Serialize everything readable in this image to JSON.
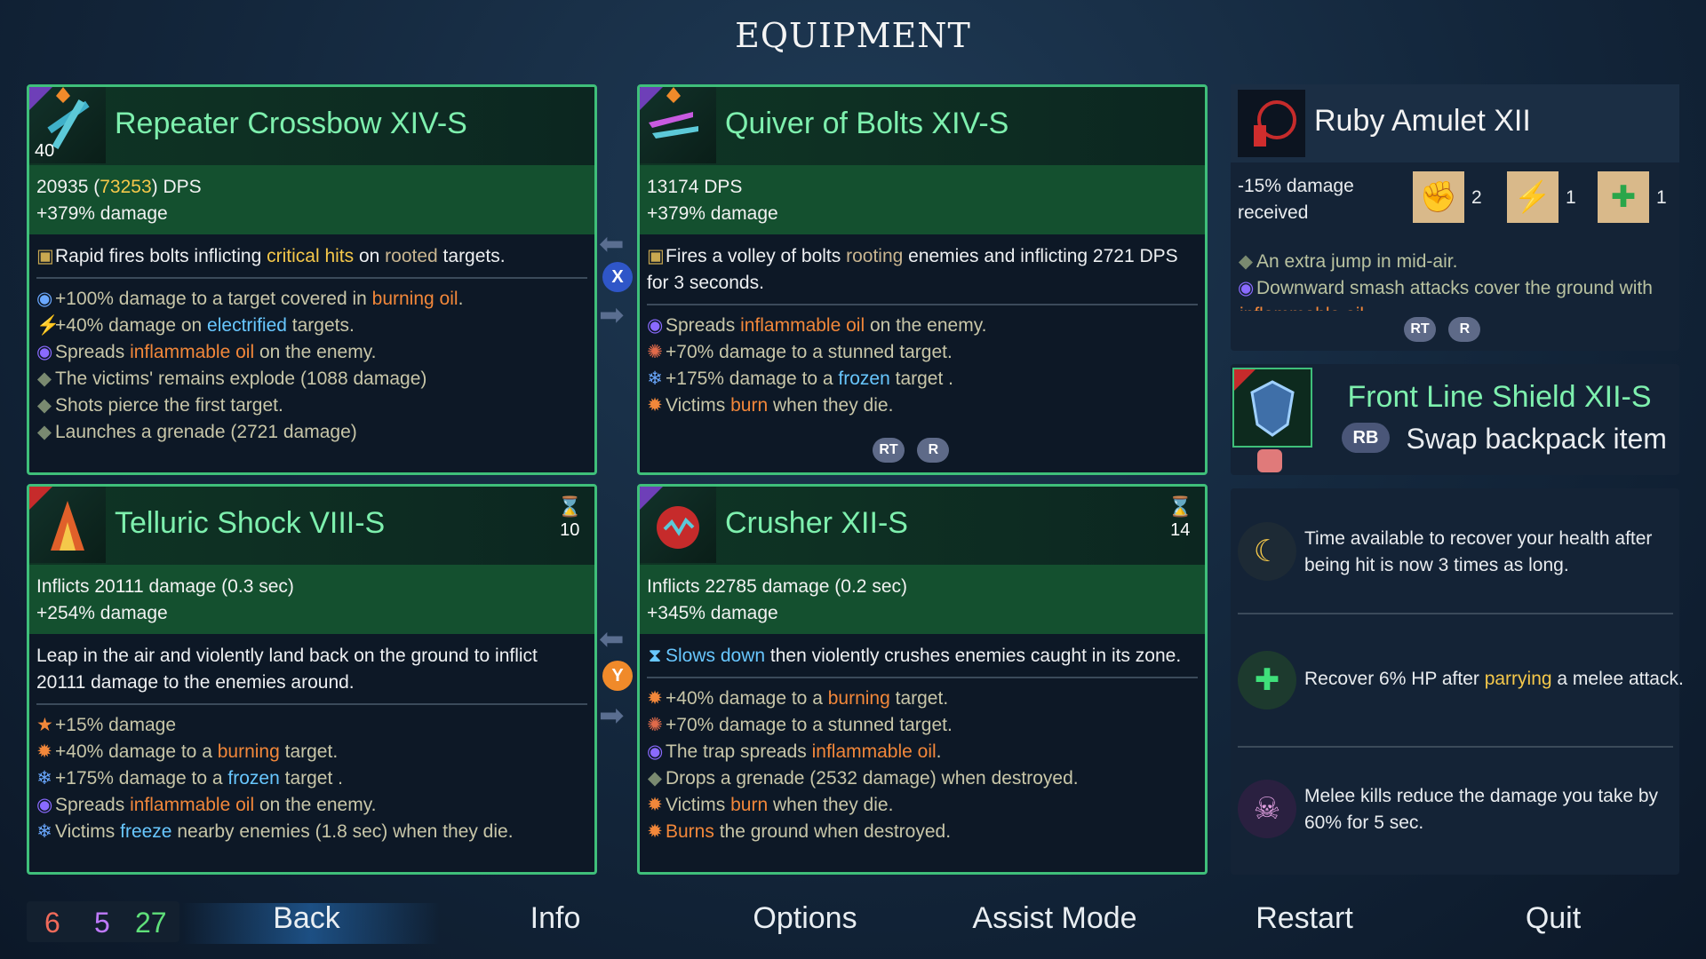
{
  "title": "EQUIPMENT",
  "weapon1": {
    "name": "Repeater Crossbow XIV-S",
    "level": "40",
    "dps_main": "20935 (",
    "dps_gold": "73253",
    "dps_suffix": ") DPS",
    "damage": "+379% damage",
    "desc_pre": "Rapid fires bolts inflicting ",
    "desc_crit": "critical hits",
    "desc_mid": " on ",
    "desc_root": "rooted",
    "desc_end": " targets.",
    "l1a": "+100% damage to a target covered in ",
    "l1b": "burning oil",
    "l1c": ".",
    "l2a": "+40% damage on ",
    "l2b": "electrified",
    "l2c": " targets.",
    "l3a": "Spreads ",
    "l3b": "inflammable oil",
    "l3c": " on the enemy.",
    "l4": "The victims' remains explode (1088 damage)",
    "l5": "Shots pierce the first target.",
    "l6": "Launches a grenade (2721 damage)"
  },
  "weapon2": {
    "name": "Quiver of Bolts XIV-S",
    "dps": "13174 DPS",
    "damage": "+379% damage",
    "desc_pre": "Fires a volley of bolts ",
    "desc_root": "rooting",
    "desc_end": " enemies and inflicting 2721 DPS for 3 seconds.",
    "l1a": "Spreads ",
    "l1b": "inflammable oil",
    "l1c": " on the enemy.",
    "l2": "+70% damage to a stunned target.",
    "l3a": "+175% damage to a ",
    "l3b": "frozen",
    "l3c": " target .",
    "l4a": "Victims ",
    "l4b": "burn",
    "l4c": " when they die.",
    "hint_rt": "RT",
    "hint_r": "R"
  },
  "amulet": {
    "name": "Ruby Amulet XII",
    "stat": "-15% damage received",
    "scroll1": "2",
    "scroll2": "1",
    "scroll3": "1",
    "l1": "An extra jump in mid-air.",
    "l2": "Downward smash attacks cover the ground with",
    "l2b": "inflammable oil",
    "hint_rt": "RT",
    "hint_r": "R"
  },
  "shield": {
    "name": "Front Line Shield XII-S",
    "rb": "RB",
    "swap": "Swap backpack item"
  },
  "mutations": [
    {
      "text": "Time available to recover your health after being hit is now 3 times as long."
    },
    {
      "pre": "Recover 6% HP after ",
      "hl": "parrying",
      "post": " a melee attack."
    },
    {
      "text": "Melee kills reduce the damage you take by 60% for 5 sec."
    }
  ],
  "skill1": {
    "name": "Telluric Shock VIII-S",
    "cooldown": "10",
    "dmg": "Inflicts 20111 damage (0.3 sec)",
    "damage": "+254% damage",
    "desc": "Leap in the air and violently land back on the ground to inflict 20111 damage to the enemies around.",
    "l1": "+15% damage",
    "l2a": "+40% damage to a ",
    "l2b": "burning",
    "l2c": " target.",
    "l3a": "+175% damage to a ",
    "l3b": "frozen",
    "l3c": " target .",
    "l4a": "Spreads ",
    "l4b": "inflammable oil",
    "l4c": " on the enemy.",
    "l5a": "Victims ",
    "l5b": "freeze",
    "l5c": " nearby enemies (1.8 sec) when they die."
  },
  "skill2": {
    "name": "Crusher XII-S",
    "cooldown": "14",
    "dmg": "Inflicts 22785 damage (0.2 sec)",
    "damage": "+345% damage",
    "desc_a": "Slows down",
    "desc_b": " then violently crushes enemies caught in its zone.",
    "l1a": "+40% damage to a ",
    "l1b": "burning",
    "l1c": " target.",
    "l2": "+70% damage to a stunned target.",
    "l3a": "The trap spreads ",
    "l3b": "inflammable oil",
    "l3c": ".",
    "l4": "Drops a grenade (2532 damage) when destroyed.",
    "l5a": "Victims ",
    "l5b": "burn",
    "l5c": " when they die.",
    "l6a": "Burns",
    "l6b": " the ground when destroyed."
  },
  "swap_x": "X",
  "swap_y": "Y",
  "counters": {
    "red": "6",
    "purple": "5",
    "green": "27"
  },
  "nav": [
    "Back",
    "Info",
    "Options",
    "Assist Mode",
    "Restart",
    "Quit"
  ]
}
